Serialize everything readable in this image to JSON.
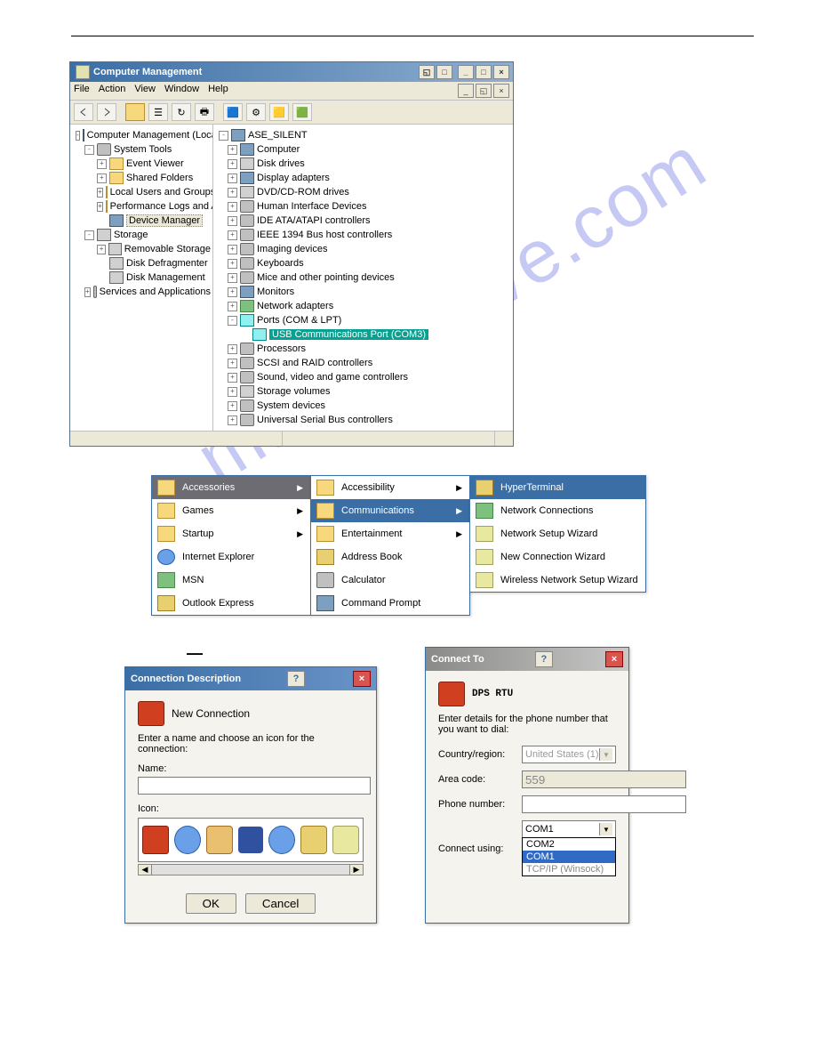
{
  "watermark": "manualslive.com",
  "cm": {
    "title": "Computer Management",
    "menu": [
      "File",
      "Action",
      "View",
      "Window",
      "Help"
    ],
    "left_tree": [
      {
        "label": "Computer Management (Local)",
        "lvl": 0,
        "exp": "-",
        "icon": "monitor"
      },
      {
        "label": "System Tools",
        "lvl": 1,
        "exp": "-",
        "icon": "gear"
      },
      {
        "label": "Event Viewer",
        "lvl": 2,
        "exp": "+",
        "icon": "folder"
      },
      {
        "label": "Shared Folders",
        "lvl": 2,
        "exp": "+",
        "icon": "folder"
      },
      {
        "label": "Local Users and Groups",
        "lvl": 2,
        "exp": "+",
        "icon": "folder"
      },
      {
        "label": "Performance Logs and Alerts",
        "lvl": 2,
        "exp": "+",
        "icon": "folder"
      },
      {
        "label": "Device Manager",
        "lvl": 2,
        "exp": "",
        "icon": "monitor",
        "selected": true
      },
      {
        "label": "Storage",
        "lvl": 1,
        "exp": "-",
        "icon": "disk"
      },
      {
        "label": "Removable Storage",
        "lvl": 2,
        "exp": "+",
        "icon": "disk"
      },
      {
        "label": "Disk Defragmenter",
        "lvl": 2,
        "exp": "",
        "icon": "disk"
      },
      {
        "label": "Disk Management",
        "lvl": 2,
        "exp": "",
        "icon": "disk"
      },
      {
        "label": "Services and Applications",
        "lvl": 1,
        "exp": "+",
        "icon": "gear"
      }
    ],
    "right_tree": [
      {
        "label": "ASE_SILENT",
        "lvl": 0,
        "exp": "-",
        "icon": "monitor"
      },
      {
        "label": "Computer",
        "lvl": 1,
        "exp": "+",
        "icon": "monitor"
      },
      {
        "label": "Disk drives",
        "lvl": 1,
        "exp": "+",
        "icon": "disk"
      },
      {
        "label": "Display adapters",
        "lvl": 1,
        "exp": "+",
        "icon": "monitor"
      },
      {
        "label": "DVD/CD-ROM drives",
        "lvl": 1,
        "exp": "+",
        "icon": "disk"
      },
      {
        "label": "Human Interface Devices",
        "lvl": 1,
        "exp": "+",
        "icon": "gear"
      },
      {
        "label": "IDE ATA/ATAPI controllers",
        "lvl": 1,
        "exp": "+",
        "icon": "gear"
      },
      {
        "label": "IEEE 1394 Bus host controllers",
        "lvl": 1,
        "exp": "+",
        "icon": "gear"
      },
      {
        "label": "Imaging devices",
        "lvl": 1,
        "exp": "+",
        "icon": "gear"
      },
      {
        "label": "Keyboards",
        "lvl": 1,
        "exp": "+",
        "icon": "gear"
      },
      {
        "label": "Mice and other pointing devices",
        "lvl": 1,
        "exp": "+",
        "icon": "gear"
      },
      {
        "label": "Monitors",
        "lvl": 1,
        "exp": "+",
        "icon": "monitor"
      },
      {
        "label": "Network adapters",
        "lvl": 1,
        "exp": "+",
        "icon": "net"
      },
      {
        "label": "Ports (COM & LPT)",
        "lvl": 1,
        "exp": "-",
        "icon": "port"
      },
      {
        "label": "USB Communications Port (COM3)",
        "lvl": 2,
        "exp": "",
        "icon": "port",
        "hl": true
      },
      {
        "label": "Processors",
        "lvl": 1,
        "exp": "+",
        "icon": "gear"
      },
      {
        "label": "SCSI and RAID controllers",
        "lvl": 1,
        "exp": "+",
        "icon": "gear"
      },
      {
        "label": "Sound, video and game controllers",
        "lvl": 1,
        "exp": "+",
        "icon": "gear"
      },
      {
        "label": "Storage volumes",
        "lvl": 1,
        "exp": "+",
        "icon": "disk"
      },
      {
        "label": "System devices",
        "lvl": 1,
        "exp": "+",
        "icon": "gear"
      },
      {
        "label": "Universal Serial Bus controllers",
        "lvl": 1,
        "exp": "+",
        "icon": "gear"
      }
    ]
  },
  "start_menu": {
    "col1": [
      {
        "label": "Accessories",
        "arrow": true,
        "hl": true,
        "icon": "folder"
      },
      {
        "label": "Games",
        "arrow": true,
        "icon": "folder"
      },
      {
        "label": "Startup",
        "arrow": true,
        "icon": "folder"
      },
      {
        "label": "Internet Explorer",
        "icon": "globe"
      },
      {
        "label": "MSN",
        "icon": "net"
      },
      {
        "label": "Outlook Express",
        "icon": "term"
      }
    ],
    "col2": [
      {
        "label": "Accessibility",
        "arrow": true,
        "icon": "folder"
      },
      {
        "label": "Communications",
        "arrow": true,
        "hl": true,
        "icon": "folder"
      },
      {
        "label": "Entertainment",
        "arrow": true,
        "icon": "folder"
      },
      {
        "label": "Address Book",
        "icon": "term"
      },
      {
        "label": "Calculator",
        "icon": "gear"
      },
      {
        "label": "Command Prompt",
        "icon": "monitor"
      }
    ],
    "col3": [
      {
        "label": "HyperTerminal",
        "hl": true,
        "icon": "term"
      },
      {
        "label": "Network Connections",
        "icon": "net"
      },
      {
        "label": "Network Setup Wizard",
        "icon": "wiz"
      },
      {
        "label": "New Connection Wizard",
        "icon": "wiz"
      },
      {
        "label": "Wireless Network Setup Wizard",
        "icon": "wiz"
      }
    ]
  },
  "dash": "—",
  "conn_desc": {
    "title": "Connection Description",
    "heading": "New Connection",
    "instruction": "Enter a name and choose an icon for the connection:",
    "name_label": "Name:",
    "name_value": "",
    "icon_label": "Icon:",
    "ok": "OK",
    "cancel": "Cancel"
  },
  "connect_to": {
    "title": "Connect To",
    "heading": "DPS RTU",
    "instruction": "Enter details for the phone number that you want to dial:",
    "country_label": "Country/region:",
    "country_value": "United States (1)",
    "area_label": "Area code:",
    "area_value": "559",
    "phone_label": "Phone number:",
    "phone_value": "",
    "connect_label": "Connect using:",
    "connect_value": "COM1",
    "options": [
      "COM2",
      "COM1",
      "TCP/IP (Winsock)"
    ]
  }
}
